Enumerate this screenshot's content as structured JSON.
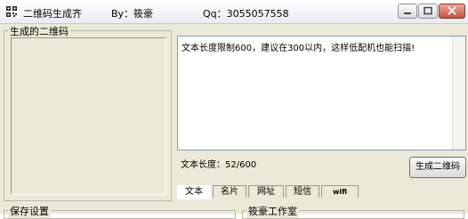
{
  "title": {
    "app_name": "二维码生成齐",
    "by_text": "By：筱豪",
    "qq_text": "Qq：3055057558"
  },
  "window_buttons": [
    "minimize",
    "maximize",
    "close"
  ],
  "qr_group": {
    "title": "生成的二维码"
  },
  "text_input": {
    "value": "文本长度限制600，建议在300以内，这样低配机也能扫描!",
    "length_label": "文本长度：52/600"
  },
  "generate_button": {
    "label": "生成二维码"
  },
  "tabs": [
    {
      "label": "文本",
      "active": true
    },
    {
      "label": "名片",
      "active": false
    },
    {
      "label": "网址",
      "active": false
    },
    {
      "label": "短信",
      "active": false
    },
    {
      "label": "wifi",
      "active": false
    }
  ],
  "bottom_groups": {
    "save_settings": "保存设置",
    "studio": "筱豪工作室"
  },
  "colors": {
    "window_bg": "#ece9d8",
    "close_button": "#c9503a",
    "input_border": "#7f9db9"
  }
}
